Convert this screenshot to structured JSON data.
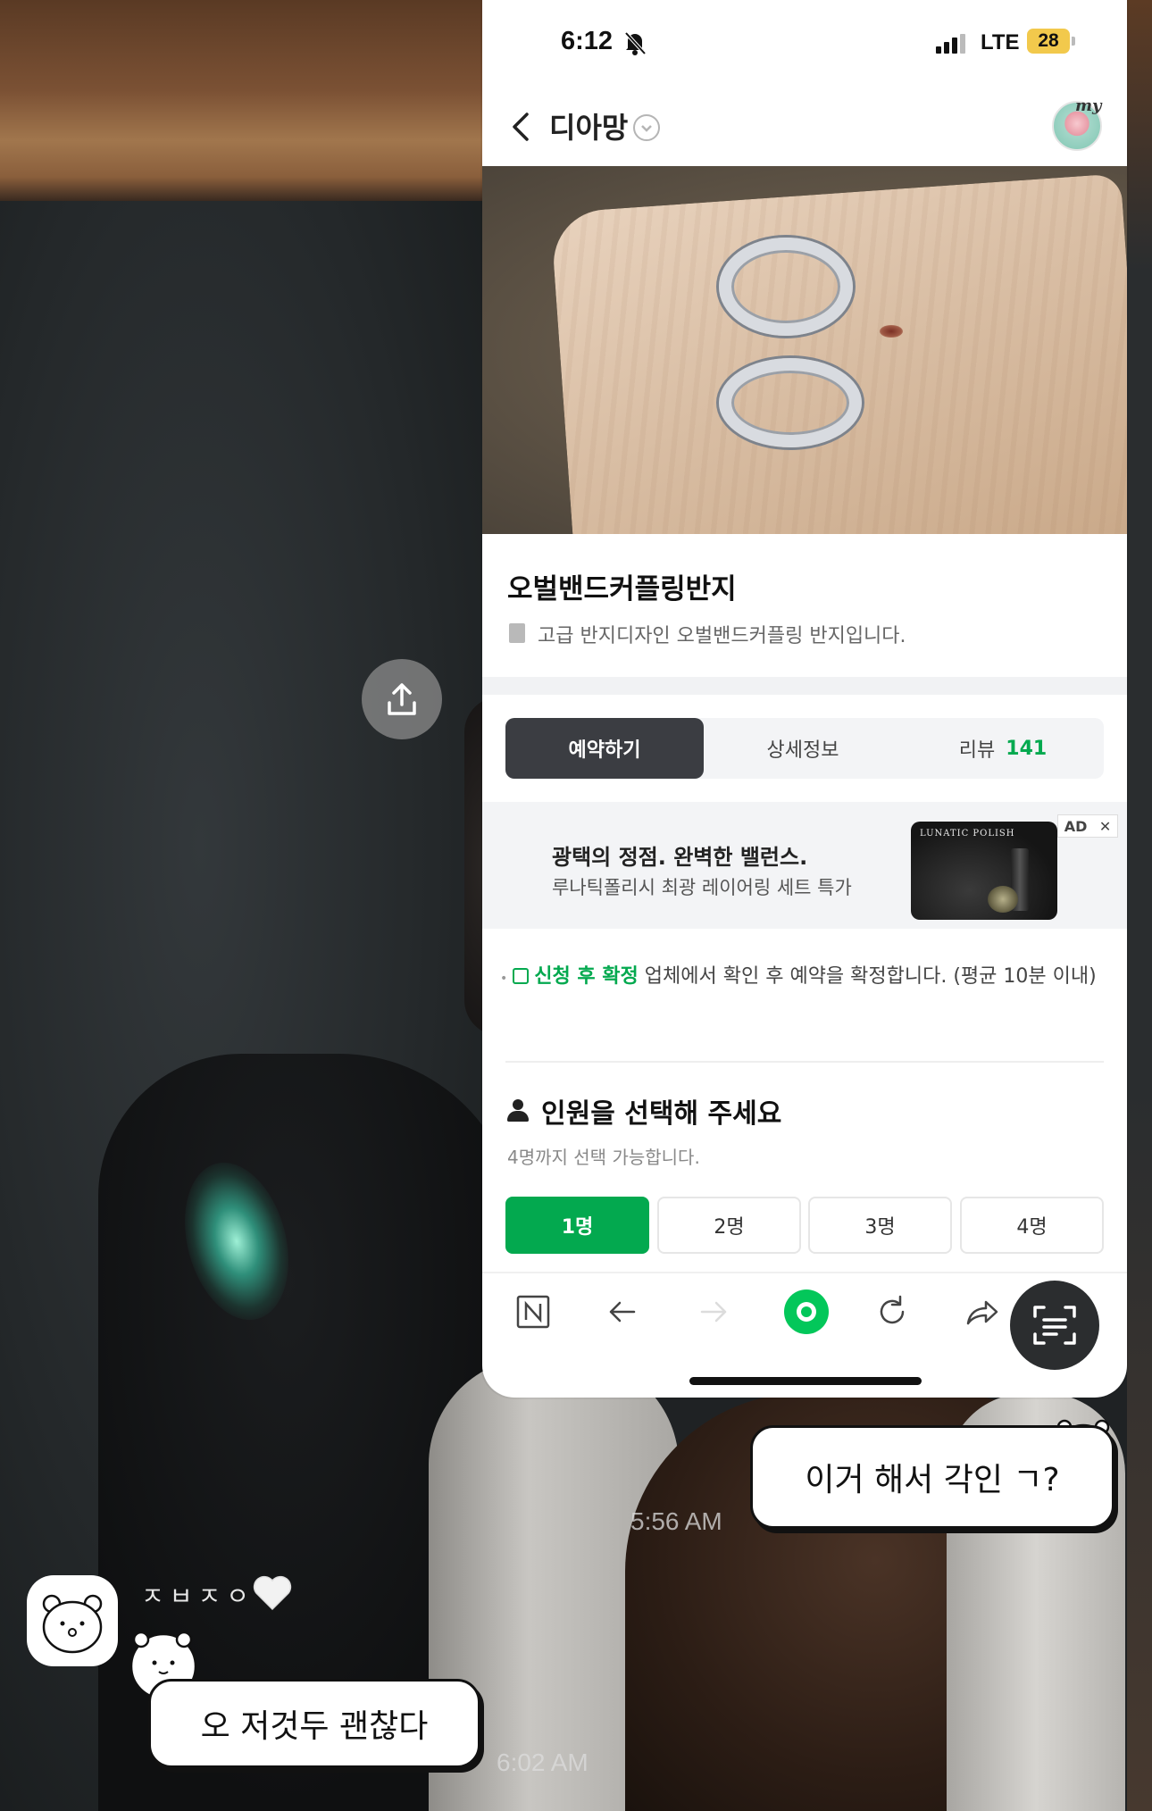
{
  "status_bar": {
    "time": "6:12",
    "network": "LTE",
    "battery": "28"
  },
  "navbar": {
    "title": "디아망",
    "avatar_label": "my"
  },
  "product": {
    "name": "오벌밴드커플링반지",
    "description": "고급 반지디자인 오벌밴드커플링 반지입니다."
  },
  "tabs": {
    "reserve": "예약하기",
    "details": "상세정보",
    "review": "리뷰",
    "review_count": "141"
  },
  "ad": {
    "title": "광택의 정점. 완벽한 밸런스.",
    "subtitle": "루나틱폴리시 최광 레이어링 세트 특가",
    "badge": "AD",
    "close": "✕",
    "image_brand": "LUNATIC POLISH"
  },
  "confirm": {
    "highlight": "신청 후 확정",
    "text": " 업체에서 확인 후 예약을 확정합니다. (평균 10분 이내)"
  },
  "people": {
    "title": "인원을 선택해 주세요",
    "subtitle": "4명까지 선택 가능합니다.",
    "options": [
      "1명",
      "2명",
      "3명",
      "4명"
    ],
    "selected_index": 0
  },
  "chat": {
    "sent_message": "이거 해서 각인 ㄱ?",
    "sent_time": "5:56 AM",
    "sender_name": "ㅈㅂㅈㅇ",
    "received_message": "오 저것두 괜찮다",
    "received_time": "6:02 AM"
  },
  "colors": {
    "accent_green": "#03a94f",
    "tab_active": "#3b3d42",
    "battery_yellow": "#f2c94c"
  },
  "icons": {
    "status": [
      "bell-slash-icon",
      "signal-icon"
    ],
    "navbar": [
      "back-chevron-icon",
      "dropdown-circle-icon"
    ],
    "browser": [
      "naver-n-icon",
      "back-arrow-icon",
      "forward-arrow-icon",
      "home-ring-icon",
      "refresh-icon",
      "share-arrow-icon"
    ],
    "overlay": [
      "share-upload-icon",
      "scan-text-icon",
      "heart-icon"
    ]
  }
}
